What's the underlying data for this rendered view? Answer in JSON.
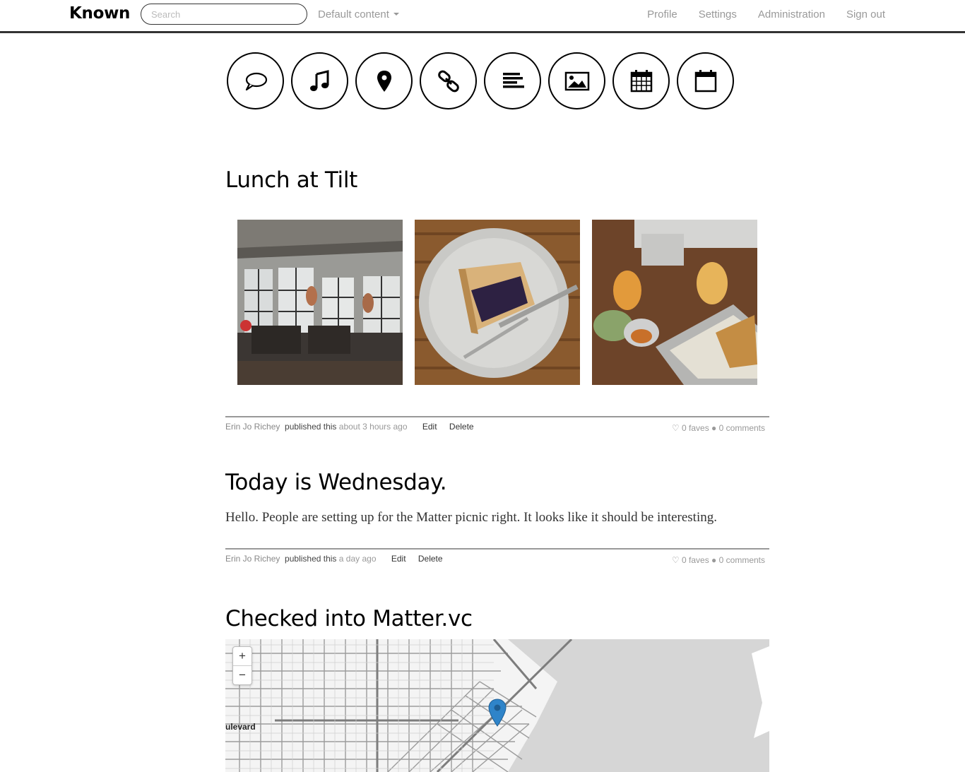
{
  "nav": {
    "brand": "Known",
    "search_placeholder": "Search",
    "filter_label": "Default content",
    "links": [
      "Profile",
      "Settings",
      "Administration",
      "Sign out"
    ]
  },
  "content_types": [
    {
      "icon": "speech-bubble-icon"
    },
    {
      "icon": "music-note-icon"
    },
    {
      "icon": "map-marker-icon"
    },
    {
      "icon": "link-icon"
    },
    {
      "icon": "text-lines-icon"
    },
    {
      "icon": "image-icon"
    },
    {
      "icon": "calendar-grid-icon"
    },
    {
      "icon": "calendar-blank-icon"
    }
  ],
  "posts": [
    {
      "title": "Lunch at Tilt",
      "author": "Erin Jo Richey",
      "published_prefix": "published this",
      "time": "about 3 hours ago",
      "edit_label": "Edit",
      "delete_label": "Delete",
      "faves": "0 faves",
      "comments": "0 comments"
    },
    {
      "title": "Today is Wednesday.",
      "body": "Hello. People are setting up for the Matter picnic right. It looks like it should be interesting.",
      "author": "Erin Jo Richey",
      "published_prefix": "published this",
      "time": "a day ago",
      "edit_label": "Edit",
      "delete_label": "Delete",
      "faves": "0 faves",
      "comments": "0 comments"
    },
    {
      "title": "Checked into Matter.vc",
      "map_label": "ulevard",
      "zoom_in": "+",
      "zoom_out": "−"
    }
  ]
}
